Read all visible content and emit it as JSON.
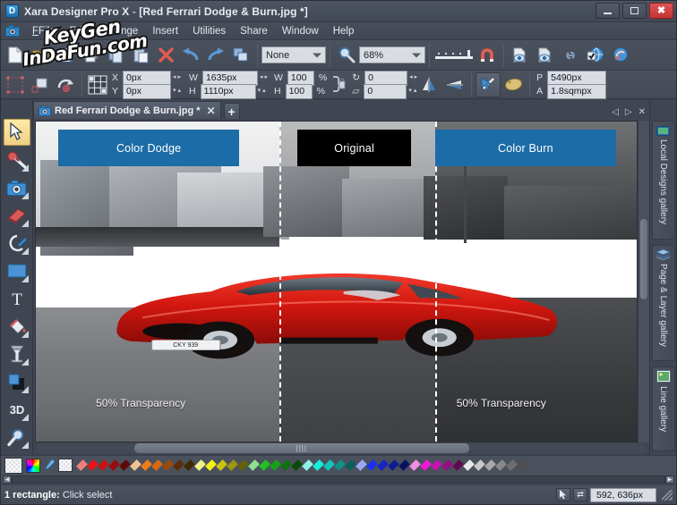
{
  "window": {
    "title_app": "Xara Designer Pro X",
    "title_sep": " - ",
    "title_doc": "[Red Ferrari Dodge & Burn.jpg *]",
    "app_icon": "D",
    "minimize": "minimize-button",
    "maximize": "maximize-button",
    "close_glyph": "✖"
  },
  "menu": {
    "camera_icon": "camera-icon",
    "items": [
      {
        "label": "File"
      },
      {
        "label": "Edit"
      },
      {
        "label": "Arrange"
      },
      {
        "label": "Insert"
      },
      {
        "label": "Utilities"
      },
      {
        "label": "Share"
      },
      {
        "label": "Window"
      },
      {
        "label": "Help"
      }
    ]
  },
  "toolbar": {
    "new_doc": "new-document-icon",
    "open": "open-folder-icon",
    "save": "save-icon",
    "print": "print-icon",
    "copy": "copy-icon",
    "paste": "paste-icon",
    "delete_glyph": "✕",
    "undo_glyph": "↺",
    "redo_glyph": "↻",
    "duplicate": "duplicate-icon",
    "quality_value": "None",
    "zoom_icon": "zoom-tool-icon",
    "zoom_value": "68%",
    "slider": "zoom-slider",
    "magnet": "snap-magnet-icon",
    "preview1": "page-preview-icon",
    "preview2": "document-preview-icon",
    "link": "link-icon",
    "web_check": "web-properties-icon",
    "share": "share-icon"
  },
  "infobar": {
    "lock_aspect_icon": "lock-aspect-icon",
    "grid_icon": "object-alignment-icon",
    "rotate_icon": "rotate-icon",
    "x_label": "X",
    "x_value": "0px",
    "y_label": "Y",
    "y_value": "0px",
    "w_label": "W",
    "w_value": "1635px",
    "h_label": "H",
    "h_value": "1110px",
    "wpct_label": "W",
    "wpct_value": "100",
    "hpct_label": "H",
    "hpct_value": "100",
    "pct_sign": "%",
    "rotate_value": "0",
    "skew_value": "0",
    "flip_h": "flip-horizontal-icon",
    "flip_v": "flip-vertical-icon",
    "select_tool": "selector-tool-icon",
    "clipart": "clipart-icon",
    "p_label": "P",
    "p_value": "5490px",
    "a_label": "A",
    "a_value": "1.8sqmpx"
  },
  "tabs": {
    "document": {
      "icon": "photo-document-icon",
      "label": "Red Ferrari Dodge & Burn.jpg *",
      "close": "✕"
    },
    "add": "+",
    "nav_prev": "◁",
    "nav_next": "▷",
    "nav_close": "✕"
  },
  "left_tools": [
    {
      "name": "selection-tool",
      "label": "Selector Tool",
      "active": true
    },
    {
      "name": "photo-enhance-tool",
      "label": "Photo Enhance Tool",
      "active": false
    },
    {
      "name": "photo-tool",
      "label": "Photo Tool",
      "active": false
    },
    {
      "name": "eraser-tool",
      "label": "Eraser Tool",
      "active": false
    },
    {
      "name": "shape-editor-tool",
      "label": "Shape Editor Tool",
      "active": false
    },
    {
      "name": "rectangle-tool",
      "label": "Rectangle Tool",
      "active": false
    },
    {
      "name": "text-tool",
      "label": "Text Tool",
      "active": false
    },
    {
      "name": "fill-tool",
      "label": "Fill Tool",
      "active": false
    },
    {
      "name": "transparency-tool",
      "label": "Transparency Tool",
      "active": false
    },
    {
      "name": "shadow-tool",
      "label": "Shadow Tool",
      "active": false
    },
    {
      "name": "extrude-tool",
      "label": "3D Extrude Tool",
      "active": false
    },
    {
      "name": "zoom-tool",
      "label": "Zoom Tool",
      "active": false
    }
  ],
  "galleries": [
    {
      "label": "Local Designs gallery",
      "icon": "designs-gallery-icon"
    },
    {
      "label": "Page & Layer gallery",
      "icon": "layers-gallery-icon"
    },
    {
      "label": "Line gallery",
      "icon": "line-gallery-icon"
    }
  ],
  "canvas": {
    "label_left": "Color Dodge",
    "label_center": "Original",
    "label_right": "Color Burn",
    "transparency_left": "50% Transparency",
    "transparency_right": "50% Transparency",
    "plate_text": "CKY 939",
    "label_blue": "#1c6ca8",
    "label_black": "#000000",
    "car_red": "#cc1a18"
  },
  "palette": {
    "no_color": "no-color-swatch",
    "color_wheel": "color-wheel-icon",
    "eyedropper": "eyedropper-icon",
    "transparent": "transparent-swatch",
    "colors": [
      "#ef8080",
      "#e81414",
      "#cc1111",
      "#9a0d0d",
      "#5e0808",
      "#f3c294",
      "#f07c1a",
      "#d86a10",
      "#9a4b0a",
      "#5c2c06",
      "#3f2a05",
      "#f2f08a",
      "#f5ef18",
      "#c9c414",
      "#9a9710",
      "#636107",
      "#8fe08f",
      "#20c020",
      "#18a018",
      "#0f700f",
      "#0a4a0a",
      "#8ff2e8",
      "#18eddd",
      "#15c5b8",
      "#0f9188",
      "#0a5f59",
      "#9aa8f2",
      "#1a2ff0",
      "#1526c4",
      "#101c92",
      "#0a1260",
      "#f28fe0",
      "#ee18d8",
      "#c514b2",
      "#93107f",
      "#600a52",
      "#e8e8e8",
      "#c8c8c8",
      "#a8a8a8",
      "#8a8a8a",
      "#6d6d6d",
      "#4f4f4f"
    ],
    "scroll_left": "◀",
    "scroll_right": "▶"
  },
  "status": {
    "object_count": "1 rectangle:",
    "hint": "Click select",
    "pointer_icon": "pointer-icon",
    "snap_icon": "snap-toggle-icon",
    "coordinates": "592, 636px"
  },
  "watermark": {
    "line1": "KeyGen",
    "line2": "InDaFun.com"
  }
}
